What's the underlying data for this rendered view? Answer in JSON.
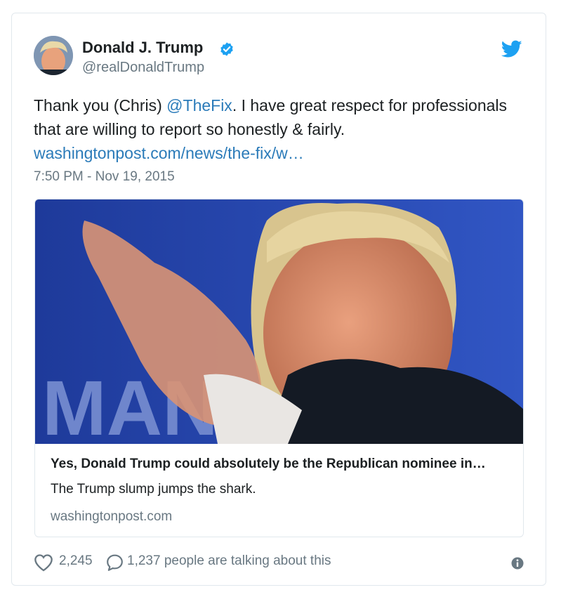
{
  "author": {
    "name": "Donald J. Trump",
    "handle": "@realDonaldTrump"
  },
  "tweet": {
    "text_before": "Thank you (Chris) ",
    "mention": "@TheFix",
    "text_after": ". I have great respect for professionals that are willing to report so honestly & fairly.",
    "link": "washingtonpost.com/news/the-fix/w…",
    "timestamp": "7:50 PM - Nov 19, 2015"
  },
  "card": {
    "title": "Yes, Donald Trump could absolutely be the Republican nominee in…",
    "description": "The Trump slump jumps the shark.",
    "domain": "washingtonpost.com",
    "image_text": "MAN"
  },
  "footer": {
    "likes": "2,245",
    "talking": "1,237 people are talking about this"
  },
  "colors": {
    "link": "#2b7bb9",
    "twitter_blue": "#1da1f2",
    "secondary_text": "#697882",
    "border": "#e1e8ed"
  },
  "icons": [
    "verified-badge-icon",
    "twitter-bird-icon",
    "heart-icon",
    "reply-bubble-icon",
    "info-icon"
  ]
}
